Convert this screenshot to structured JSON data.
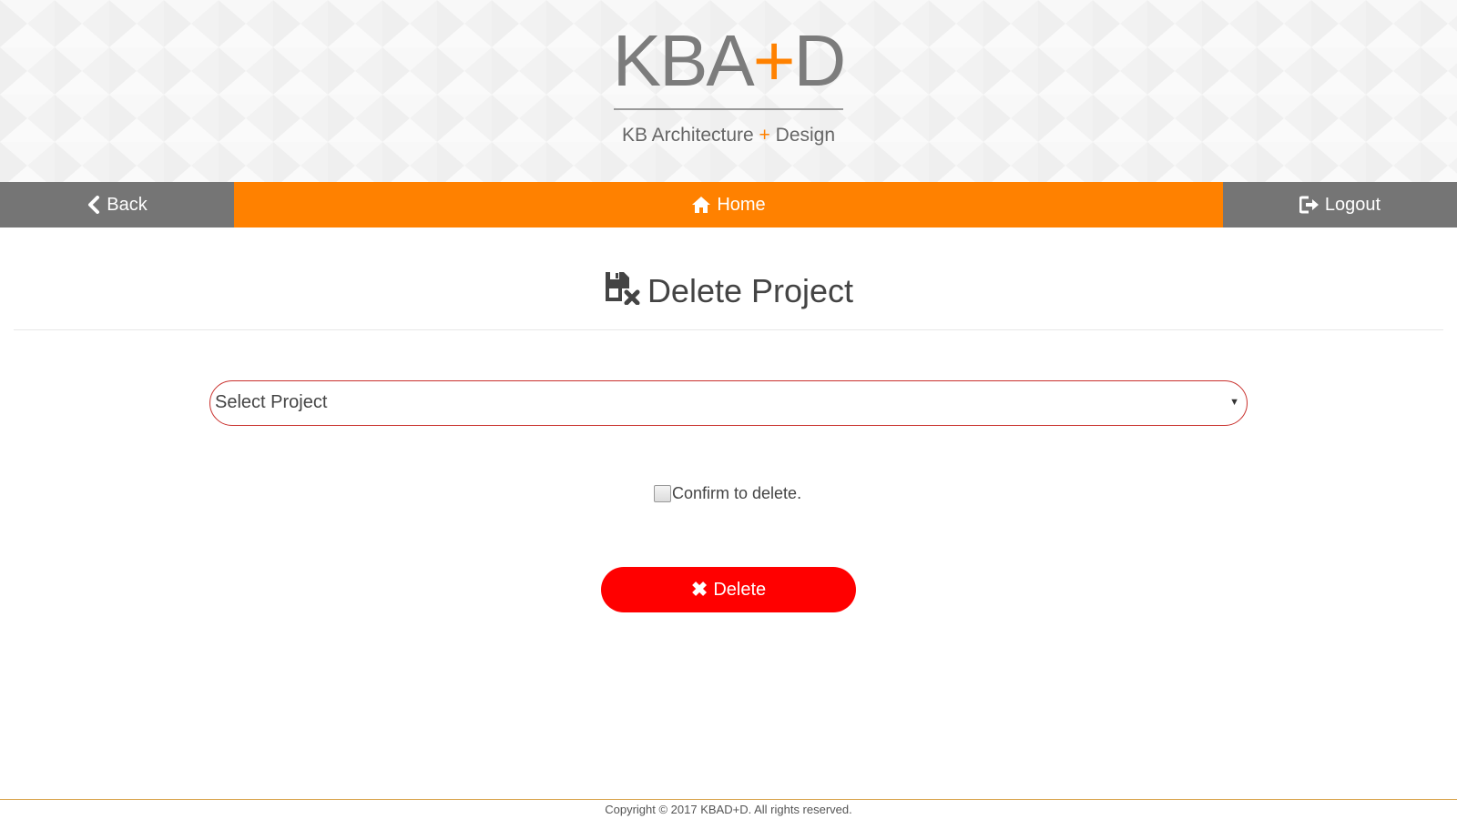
{
  "header": {
    "logo_prefix": "KBA",
    "logo_plus": "+",
    "logo_suffix": "D",
    "tagline_left": "KB Architecture",
    "tagline_plus": "+",
    "tagline_right": "Design"
  },
  "nav": {
    "back_label": "Back",
    "home_label": "Home",
    "logout_label": "Logout",
    "back_icon": "chevron-left-icon",
    "home_icon": "home-icon",
    "logout_icon": "logout-icon"
  },
  "page": {
    "title": "Delete Project",
    "title_icon": "delete-file-icon"
  },
  "form": {
    "project_select_value": "Select Project",
    "confirm_label": "Confirm to delete.",
    "confirm_checked": false,
    "delete_label": "Delete",
    "delete_icon": "close-icon"
  },
  "footer": {
    "copyright": "Copyright © 2017 KBAD+D. All rights reserved."
  },
  "colors": {
    "accent_orange": "#ff8100",
    "nav_gray": "#757575",
    "danger_red": "#ff0000",
    "select_border": "#c9302c"
  }
}
